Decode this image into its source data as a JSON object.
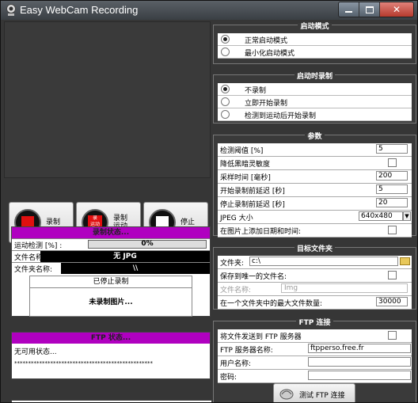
{
  "window": {
    "title": "Easy WebCam Recording"
  },
  "buttons": {
    "record": "录制",
    "record_motion": "录制\n运动",
    "stop": "停止",
    "record_motion_icon_text": "录\n运动"
  },
  "record_status": {
    "header": "录制状态...",
    "motion_label": "运动检测 [%] :",
    "motion_value": "0%",
    "file_name_label": "文件名称:",
    "file_name_value": "无 JPG",
    "folder_name_label": "文件夹名称:",
    "folder_name_value": "\\\\",
    "state": "已停止录制",
    "no_image": "未录制图片..."
  },
  "ftp_status": {
    "header": "FTP 状态...",
    "text": "无可用状态...",
    "stars": "**************************************************"
  },
  "startup_mode": {
    "title": "启动模式",
    "options": [
      {
        "label": "正常启动模式",
        "selected": true
      },
      {
        "label": "最小化启动模式",
        "selected": false
      }
    ]
  },
  "start_record": {
    "title": "启动时录制",
    "options": [
      {
        "label": "不录制",
        "selected": true
      },
      {
        "label": "立即开始录制",
        "selected": false
      },
      {
        "label": "检测到运动后开始录制",
        "selected": false
      }
    ]
  },
  "params": {
    "title": "参数",
    "rows": [
      {
        "label": "检测阈值 [%]",
        "value": "5"
      },
      {
        "label": "降低黑暗灵敏度",
        "value": ""
      },
      {
        "label": "采样时间 [毫秒]",
        "value": "200"
      },
      {
        "label": "开始录制前延迟 [秒]",
        "value": "5"
      },
      {
        "label": "停止录制前延迟 [秒]",
        "value": "20"
      },
      {
        "label": "JPEG 大小",
        "value": "640x480"
      },
      {
        "label": "在图片上添加日期和时间:",
        "value": ""
      }
    ]
  },
  "target_folder": {
    "title": "目标文件夹",
    "folder_label": "文件夹:",
    "folder_value": "c:\\",
    "unique_label": "保存到唯一的文件名:",
    "filename_label": "文件名称:",
    "filename_placeholder": "Img",
    "max_label": "在一个文件夹中的最大文件数量:",
    "max_value": "30000"
  },
  "ftp": {
    "title": "FTP 连接",
    "send_label": "将文件发送到 FTP 服务器",
    "server_label": "FTP 服务器名称:",
    "server_value": "ftpperso.free.fr",
    "user_label": "用户名称:",
    "password_label": "密码:",
    "test_button": "测试 FTP 连接"
  }
}
